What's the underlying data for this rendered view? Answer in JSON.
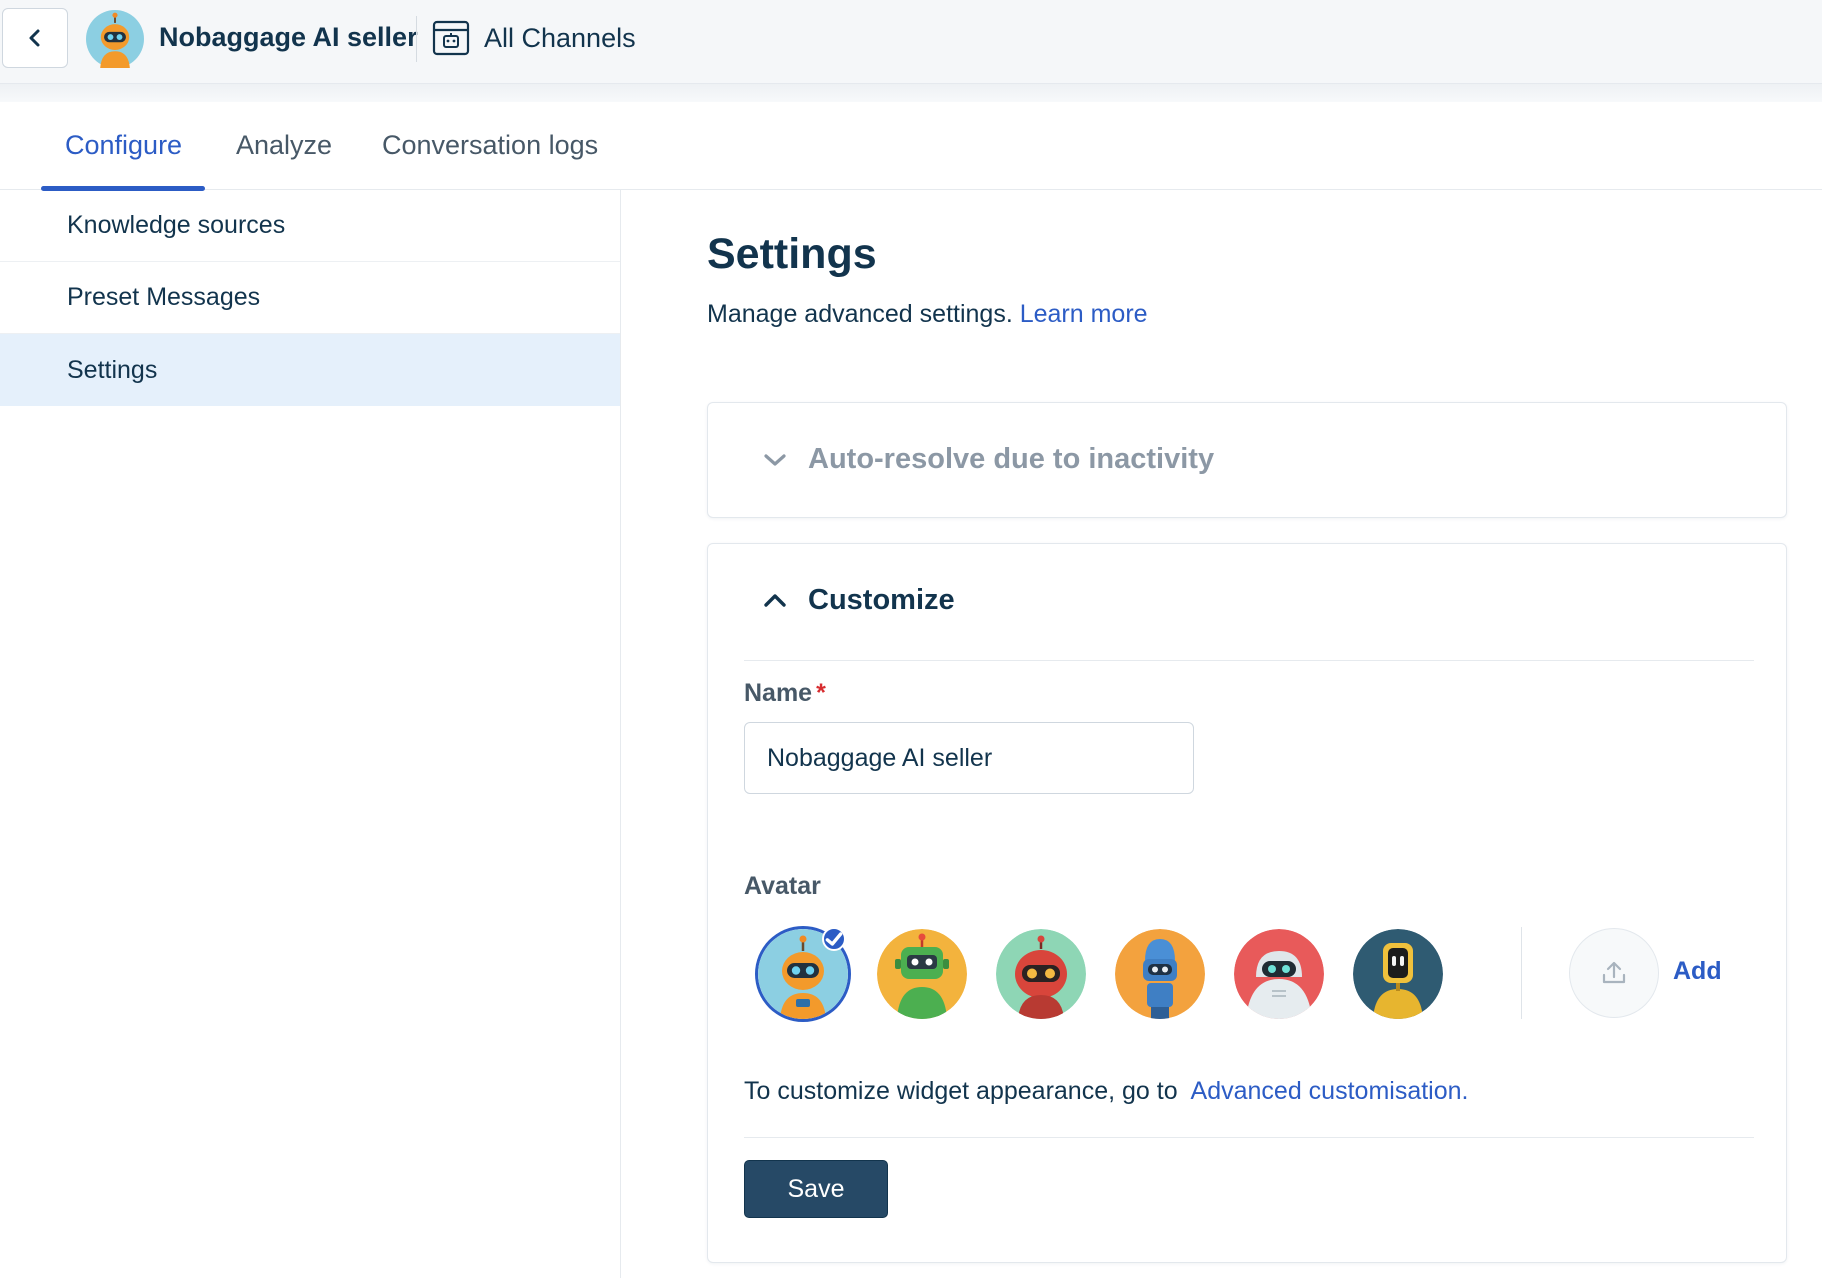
{
  "header": {
    "agent_name": "Nobaggage AI seller",
    "channel_label": "All Channels"
  },
  "tabs": [
    {
      "label": "Configure",
      "active": true
    },
    {
      "label": "Analyze",
      "active": false
    },
    {
      "label": "Conversation logs",
      "active": false
    }
  ],
  "sidebar": {
    "items": [
      {
        "label": "Knowledge sources",
        "active": false
      },
      {
        "label": "Preset Messages",
        "active": false
      },
      {
        "label": "Settings",
        "active": true
      }
    ]
  },
  "main": {
    "title": "Settings",
    "subtitle": "Manage advanced settings.",
    "learn_more": "Learn more"
  },
  "auto_resolve": {
    "title": "Auto-resolve due to inactivity",
    "expanded": false
  },
  "customize": {
    "title": "Customize",
    "expanded": true,
    "name_label": "Name",
    "required_mark": "*",
    "name_value": "Nobaggage AI seller",
    "avatar_label": "Avatar",
    "avatars": [
      {
        "icon": "orange-robot-avatar-icon",
        "selected": true
      },
      {
        "icon": "green-robot-avatar-icon",
        "selected": false
      },
      {
        "icon": "red-robot-avatar-icon",
        "selected": false
      },
      {
        "icon": "blue-robot-avatar-icon",
        "selected": false
      },
      {
        "icon": "white-robot-avatar-icon",
        "selected": false
      },
      {
        "icon": "yellow-robot-avatar-icon",
        "selected": false
      }
    ],
    "add_label": "Add",
    "note_text": "To customize widget appearance, go to",
    "note_link": "Advanced customisation.",
    "save_label": "Save"
  },
  "colors": {
    "accent": "#2c5cc5",
    "primary_button": "#264966",
    "text": "#12344d",
    "sidebar_active": "#e5f0fb"
  }
}
